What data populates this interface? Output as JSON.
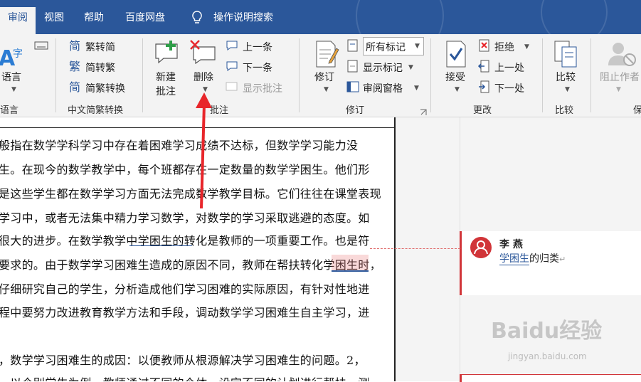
{
  "tabs": [
    {
      "label": "审阅",
      "active": true
    },
    {
      "label": "视图"
    },
    {
      "label": "帮助"
    },
    {
      "label": "百度网盘"
    },
    {
      "label": "操作说明搜索"
    }
  ],
  "ribbon": {
    "language": {
      "label": "语言",
      "group": "语言"
    },
    "chinese": {
      "items": [
        "繁转简",
        "简转繁",
        "简繁转换"
      ],
      "group": "中文简繁转换"
    },
    "comments": {
      "new": "新建\n批注",
      "new_line1": "新建",
      "new_line2": "批注",
      "delete": "删除",
      "prev": "上一条",
      "next": "下一条",
      "show": "显示批注",
      "group": "批注"
    },
    "tracking": {
      "track": "修订",
      "display_select": "所有标记",
      "show_markup": "显示标记",
      "review_pane": "审阅窗格",
      "group": "修订"
    },
    "changes": {
      "accept": "接受",
      "reject": "拒绝",
      "prev": "上一处",
      "next": "下一处",
      "group": "更改"
    },
    "compare": {
      "label": "比较",
      "group": "比较"
    },
    "protect": {
      "label": "阻止作者",
      "group": "保"
    }
  },
  "document": {
    "lines": [
      "般指在数学学科学习中存在着困难学习成绩不达标，但数学学习能力没",
      "生。在现今的数学教学中，每个班都存在一定数量的数学学困生。他们形",
      "是这些学生都在数学学习方面无法完成数学教学目标。它们往往在课堂表现",
      "学习中，或者无法集中精力学习数学，对数学的学习采取逃避的态度。如",
      "很大的进步。在数学教学中学困生的转化是教师的一项重要工作。也是符",
      "要求的。由于数学学习困难生造成的原因不同，教师在帮扶转化学困生时，",
      "仔细研究自己的学生，分析造成他们学习困难的实际原因，有针对性地进",
      "程中要努力改进教育教学方法和手段，调动数学学习困难生自主学习，进",
      "，数学学习困难生的成因：以便教师从根源解决学习困难生的问题。2，",
      "，以个别学生为例，教师通过不同的个体，设定不同的计划进行帮扶，测"
    ]
  },
  "comment": {
    "author": "李 燕",
    "text_link": "学困生",
    "text_rest": "的归类"
  },
  "watermark": {
    "brand": "Baidu经验",
    "url": "jingyan.baidu.com"
  },
  "colors": {
    "titlebar": "#2b579a",
    "ribbon": "#f3f3f3",
    "comment_bar": "#d13438",
    "arrow": "#e8262b"
  }
}
